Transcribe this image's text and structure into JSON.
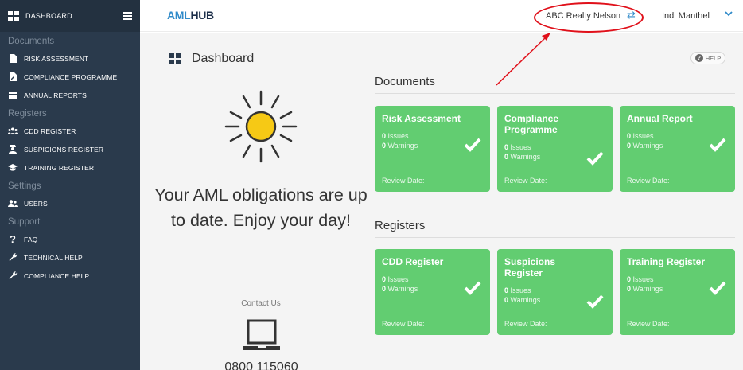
{
  "sidebar": {
    "header_label": "DASHBOARD",
    "sections": {
      "documents": "Documents",
      "registers": "Registers",
      "settings": "Settings",
      "support": "Support"
    },
    "items": {
      "risk_assessment": "RISK ASSESSMENT",
      "compliance_programme": "COMPLIANCE PROGRAMME",
      "annual_reports": "ANNUAL REPORTS",
      "cdd_register": "CDD REGISTER",
      "suspicions_register": "SUSPICIONS REGISTER",
      "training_register": "TRAINING REGISTER",
      "users": "USERS",
      "faq": "FAQ",
      "technical_help": "TECHNICAL HELP",
      "compliance_help": "COMPLIANCE HELP"
    }
  },
  "topbar": {
    "logo_aml": "AML",
    "logo_hub": "HUB",
    "organisation": "ABC Realty Nelson",
    "user_name": "Indi Manthel"
  },
  "page": {
    "title": "Dashboard",
    "help_label": "HELP",
    "status_message": "Your AML obligations are up to date. Enjoy your day!",
    "contact_label": "Contact Us",
    "phone": "0800 115060"
  },
  "documents": {
    "title": "Documents",
    "cards": [
      {
        "title": "Risk Assessment",
        "issues": "0",
        "issues_label": " Issues",
        "warnings": "0",
        "warnings_label": " Warnings",
        "review": "Review Date:"
      },
      {
        "title": "Compliance Programme",
        "issues": "0",
        "issues_label": " Issues",
        "warnings": "0",
        "warnings_label": " Warnings",
        "review": "Review Date:"
      },
      {
        "title": "Annual Report",
        "issues": "0",
        "issues_label": " Issues",
        "warnings": "0",
        "warnings_label": " Warnings",
        "review": "Review Date:"
      }
    ]
  },
  "registers": {
    "title": "Registers",
    "cards": [
      {
        "title": "CDD Register",
        "issues": "0",
        "issues_label": " Issues",
        "warnings": "0",
        "warnings_label": " Warnings",
        "review": "Review Date:"
      },
      {
        "title": "Suspicions Register",
        "issues": "0",
        "issues_label": " Issues",
        "warnings": "0",
        "warnings_label": " Warnings",
        "review": "Review Date:"
      },
      {
        "title": "Training Register",
        "issues": "0",
        "issues_label": " Issues",
        "warnings": "0",
        "warnings_label": " Warnings",
        "review": "Review Date:"
      }
    ]
  },
  "colors": {
    "sidebar_bg": "#2a3a4c",
    "card_green": "#62cd71",
    "accent_blue": "#2f8ac9",
    "annotation_red": "#e0101a"
  },
  "icons": {
    "dashboard": "dashboard-grid-icon",
    "menu": "hamburger-menu-icon",
    "swap": "swap-arrows-icon",
    "dropdown": "chevron-down-icon",
    "status": "sun-icon",
    "contact": "laptop-icon",
    "card_status": "checkmark-icon"
  }
}
